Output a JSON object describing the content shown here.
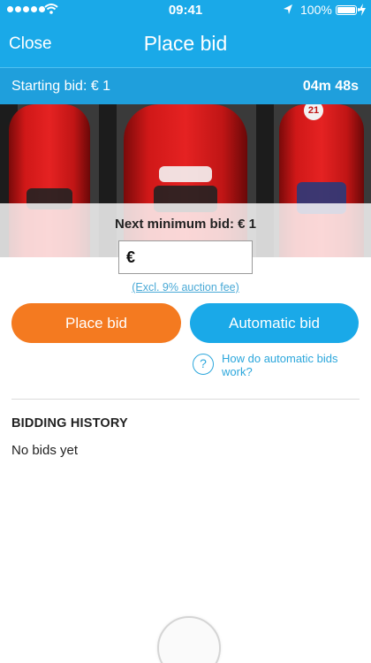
{
  "status_bar": {
    "time": "09:41",
    "battery_percent": "100%",
    "icons": [
      "signal-dots-icon",
      "wifi-icon",
      "location-arrow-icon",
      "battery-icon",
      "charging-icon"
    ]
  },
  "nav": {
    "close_label": "Close",
    "title": "Place bid"
  },
  "auction": {
    "starting_bid": "Starting bid: € 1",
    "time_left": "04m 48s"
  },
  "bid": {
    "next_minimum": "Next minimum bid: € 1",
    "currency_symbol": "€",
    "input_value": "",
    "input_placeholder": "",
    "fee_note": "(Excl. 9% auction fee)"
  },
  "buttons": {
    "place_bid": "Place bid",
    "automatic_bid": "Automatic bid"
  },
  "help": {
    "icon_glyph": "?",
    "link_text": "How do automatic bids work?"
  },
  "history": {
    "title": "BIDDING HISTORY",
    "empty_text": "No bids yet"
  },
  "colors": {
    "brand_blue": "#1aa9e8",
    "accent_orange": "#f47a20",
    "link_blue": "#2ca7dc"
  }
}
